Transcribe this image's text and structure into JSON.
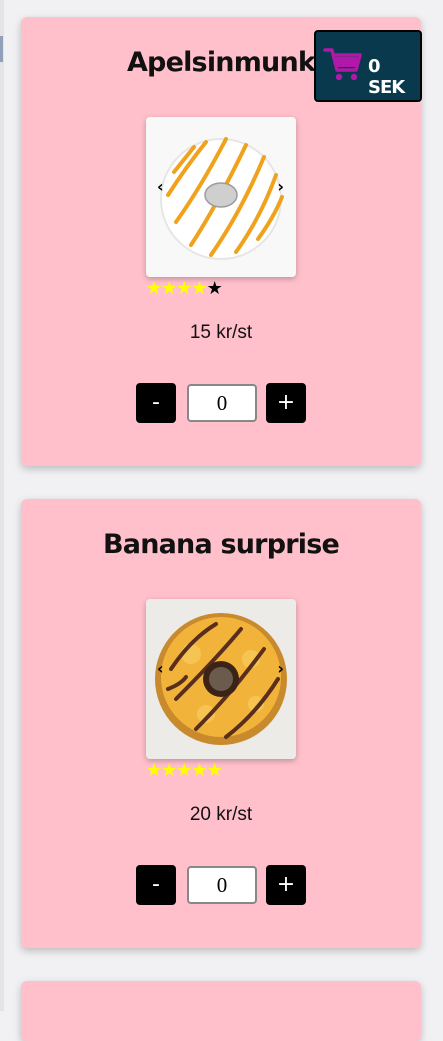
{
  "cart": {
    "label": "0 SEK",
    "icon": "shopping-cart-icon",
    "icon_color": "#b118a8",
    "background": "#08394d"
  },
  "products": [
    {
      "name": "Apelsinmunk",
      "price": "15 kr/st",
      "rating": 4,
      "rating_max": 5,
      "quantity": "0",
      "minus_label": "-",
      "plus_label": "+",
      "prev_label": "‹",
      "next_label": "›"
    },
    {
      "name": "Banana surprise",
      "price": "20 kr/st",
      "rating": 5,
      "rating_max": 5,
      "quantity": "0",
      "minus_label": "-",
      "plus_label": "+",
      "prev_label": "‹",
      "next_label": "›"
    }
  ],
  "colors": {
    "card_background": "#ffc0cb",
    "star_filled": "#ffff00",
    "star_empty": "#000000",
    "button_background": "#000000"
  }
}
